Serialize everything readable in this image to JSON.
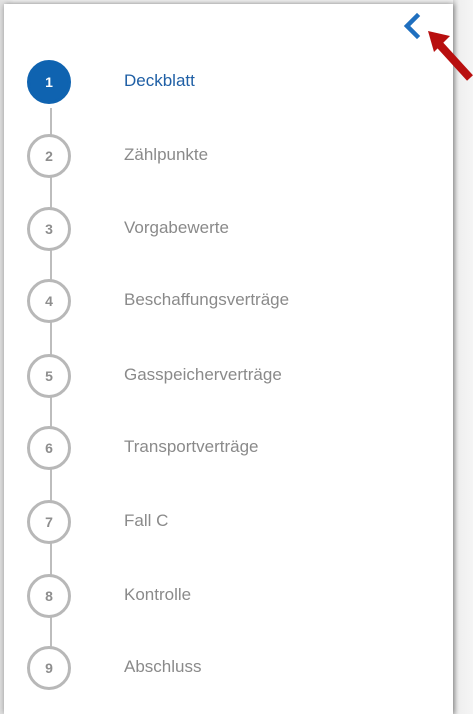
{
  "nav": {
    "collapse_icon": "chevron-left-icon",
    "accent_color": "#0f63b0",
    "steps": [
      {
        "number": "1",
        "label": "Deckblatt",
        "active": true
      },
      {
        "number": "2",
        "label": "Zählpunkte",
        "active": false
      },
      {
        "number": "3",
        "label": "Vorgabewerte",
        "active": false
      },
      {
        "number": "4",
        "label": "Beschaffungsverträge",
        "active": false
      },
      {
        "number": "5",
        "label": "Gasspeicherverträge",
        "active": false
      },
      {
        "number": "6",
        "label": "Transportverträge",
        "active": false
      },
      {
        "number": "7",
        "label": "Fall C",
        "active": false
      },
      {
        "number": "8",
        "label": "Kontrolle",
        "active": false
      },
      {
        "number": "9",
        "label": "Abschluss",
        "active": false
      }
    ]
  },
  "annotation": {
    "pointer_icon": "red-arrow-icon",
    "pointer_color": "#b80f0f"
  }
}
